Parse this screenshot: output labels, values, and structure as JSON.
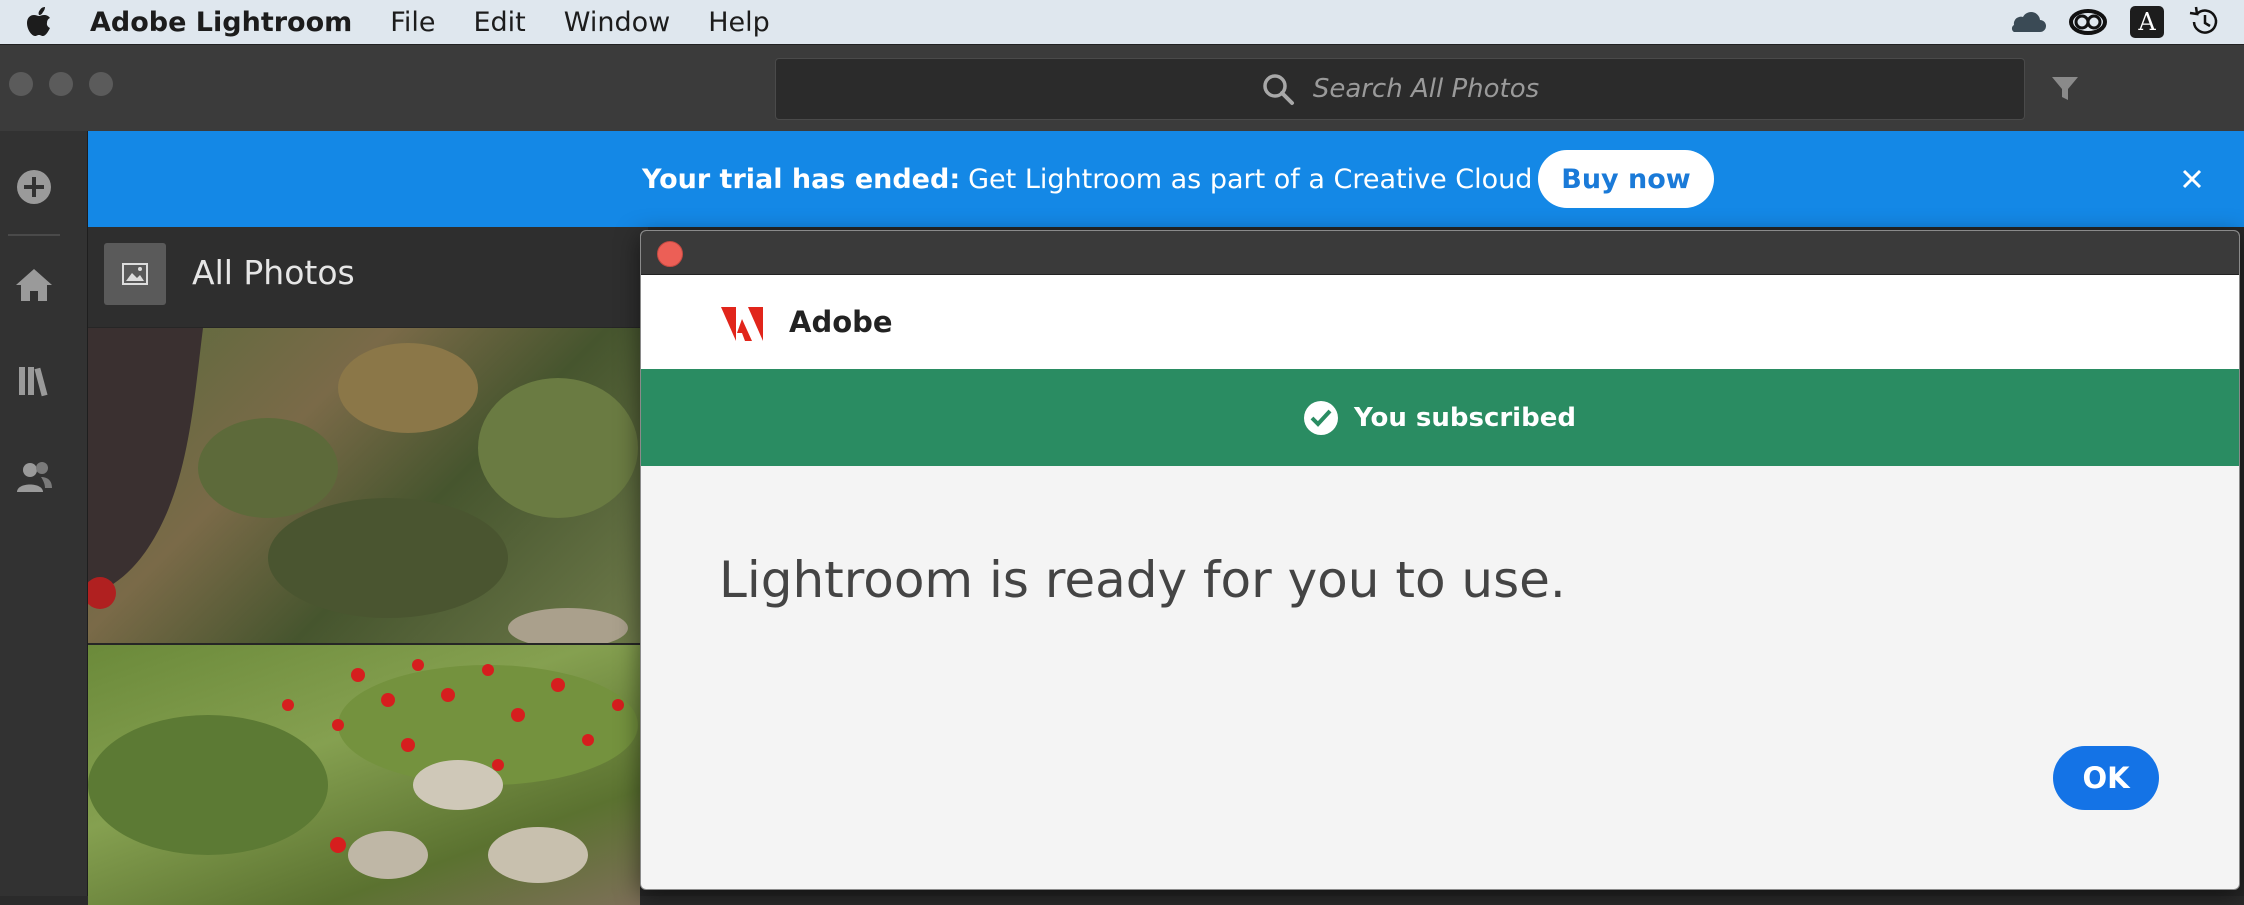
{
  "menubar": {
    "apple_icon": "apple-logo-icon",
    "app_name": "Adobe Lightroom",
    "items": [
      "File",
      "Edit",
      "Window",
      "Help"
    ],
    "status_icons": [
      "onedrive-cloud-icon",
      "creative-cloud-icon",
      "input-source-icon",
      "time-machine-icon"
    ],
    "input_source_label": "A"
  },
  "toolbar": {
    "search_placeholder": "Search All Photos",
    "filter_icon": "filter-icon"
  },
  "rail": {
    "items": [
      "add-photos-icon",
      "home-icon",
      "library-icon",
      "shared-people-icon"
    ]
  },
  "banner": {
    "bold_text": "Your trial has ended:",
    "text": "Get Lightroom as part of a Creative Cloud plan.",
    "buy_label": "Buy now",
    "close_icon": "close-icon",
    "color": "#1488e6"
  },
  "content": {
    "title": "All Photos"
  },
  "dialog": {
    "brand": "Adobe",
    "status_text": "You subscribed",
    "status_color": "#2a8c62",
    "message": "Lightroom is ready for you to use.",
    "ok_label": "OK",
    "ok_color": "#1473e6"
  }
}
